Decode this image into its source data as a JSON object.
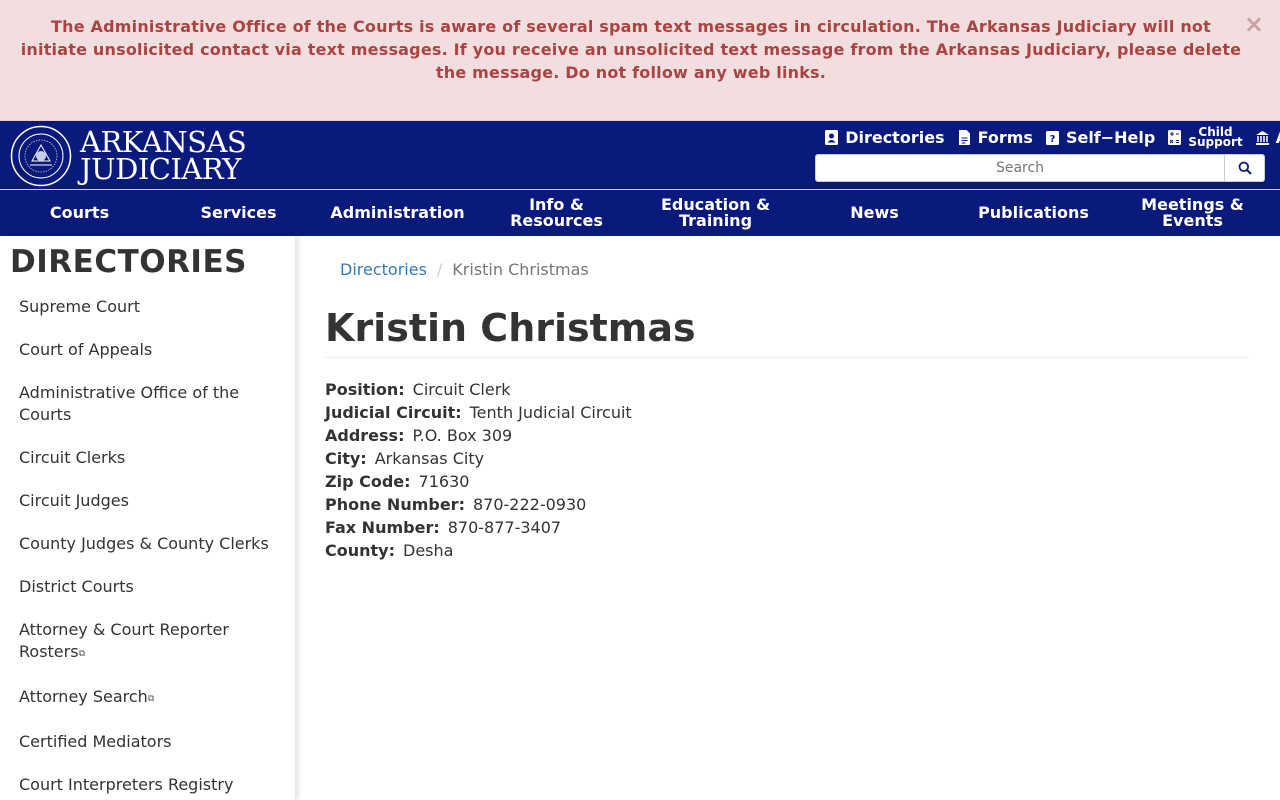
{
  "alert": {
    "message": "The Administrative Office of the Courts is aware of several spam text messages in circulation.  The Arkansas Judiciary will not initiate unsolicited contact via text messages. If you receive an unsolicited text message from the Arkansas Judiciary, please delete the message. Do not follow any web links.",
    "close_label": "×"
  },
  "brand": {
    "line1": "ARKANSAS",
    "line2": "JUDICIARY"
  },
  "utility": {
    "directories": "Directories",
    "forms": "Forms",
    "self_help": "Self−Help",
    "child_support_line1": "Child",
    "child_support_line2": "Support",
    "more": "A"
  },
  "search": {
    "placeholder": "Search"
  },
  "nav": {
    "courts": "Courts",
    "services": "Services",
    "administration": "Administration",
    "info_l1": "Info &",
    "info_l2": "Resources",
    "edu_l1": "Education &",
    "edu_l2": "Training",
    "news": "News",
    "publications": "Publications",
    "meet_l1": "Meetings &",
    "meet_l2": "Events"
  },
  "sidebar": {
    "title": "DIRECTORIES",
    "items": [
      {
        "label": "Supreme Court"
      },
      {
        "label": "Court of Appeals"
      },
      {
        "label": "Administrative Office of the Courts"
      },
      {
        "label": "Circuit Clerks"
      },
      {
        "label": "Circuit Judges"
      },
      {
        "label": "County Judges & County Clerks"
      },
      {
        "label": "District Courts"
      },
      {
        "label": "Attorney & Court Reporter Rosters"
      },
      {
        "label": "Attorney Search"
      },
      {
        "label": "Certified Mediators"
      },
      {
        "label": "Court Interpreters Registry"
      }
    ]
  },
  "breadcrumb": {
    "parent": "Directories",
    "separator": "/",
    "current": "Kristin Christmas"
  },
  "page_title": "Kristin Christmas",
  "details": {
    "position_label": "Position:",
    "position": "Circuit Clerk",
    "circuit_label": "Judicial Circuit:",
    "circuit": "Tenth Judicial Circuit",
    "address_label": "Address:",
    "address": "P.O. Box 309",
    "city_label": "City:",
    "city": "Arkansas City",
    "zip_label": "Zip Code:",
    "zip": "71630",
    "phone_label": "Phone Number:",
    "phone": "870-222-0930",
    "fax_label": "Fax Number:",
    "fax": "870-877-3407",
    "county_label": "County:",
    "county": "Desha"
  },
  "colors": {
    "header": "#0a1a7c",
    "alert_bg": "#f2dede",
    "alert_text": "#a94442",
    "link": "#337ab7"
  }
}
